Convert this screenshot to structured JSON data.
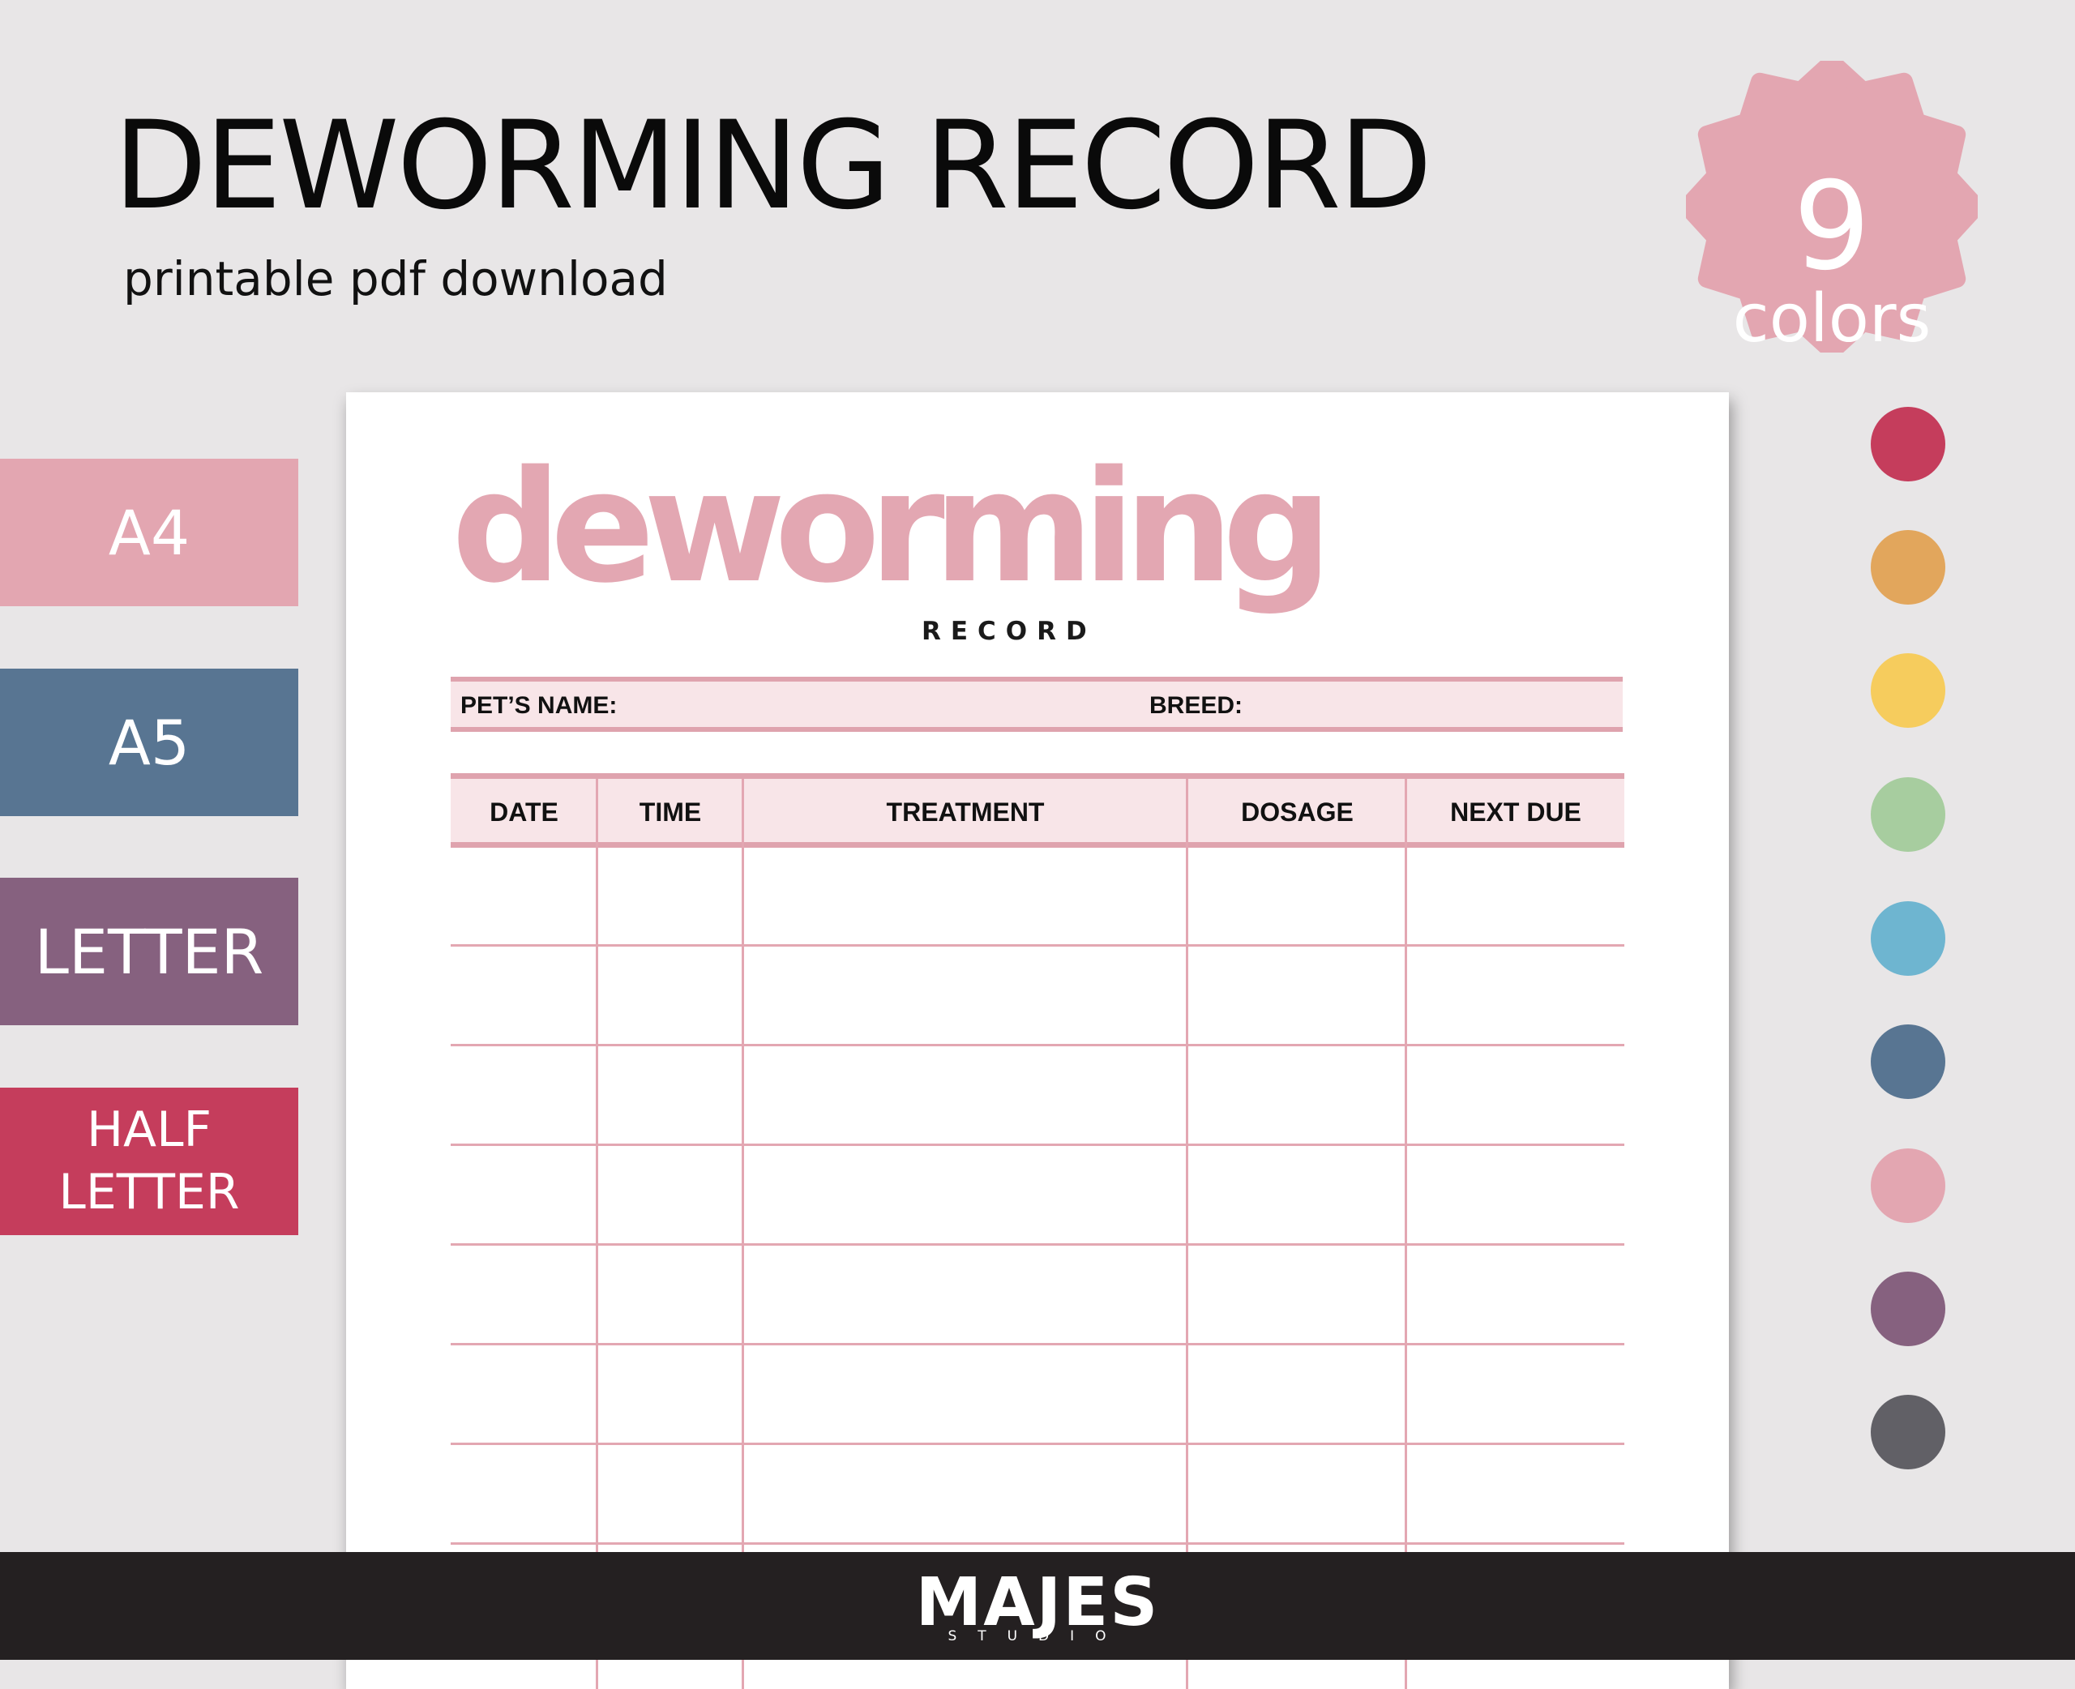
{
  "header": {
    "title": "DEWORMING RECORD",
    "subtitle": "printable pdf download"
  },
  "badge": {
    "number": "9",
    "label": "colors",
    "color": "#e3a6b1"
  },
  "sizes": [
    {
      "label": "A4",
      "color": "#e3a6b1"
    },
    {
      "label": "A5",
      "color": "#587592"
    },
    {
      "label": "LETTER",
      "color": "#86617f"
    },
    {
      "label_line1": "HALF",
      "label_line2": "LETTER",
      "color": "#c53d5c"
    }
  ],
  "sheet": {
    "logo_word": "deworming",
    "logo_sub": "RECORD",
    "pet_name_label": "PET’S NAME:",
    "breed_label": "BREED:",
    "columns": [
      "DATE",
      "TIME",
      "TREATMENT",
      "DOSAGE",
      "NEXT DUE"
    ],
    "accent_color": "#e3a7b2",
    "fill_color": "#f8e5e8"
  },
  "palette": [
    {
      "name": "crimson",
      "color": "#c53d5c"
    },
    {
      "name": "orange",
      "color": "#e2a65c"
    },
    {
      "name": "yellow",
      "color": "#f6cc5d"
    },
    {
      "name": "green",
      "color": "#a7cd9f"
    },
    {
      "name": "sky-blue",
      "color": "#6eb5d0"
    },
    {
      "name": "slate-blue",
      "color": "#587592"
    },
    {
      "name": "pink",
      "color": "#e3a6b1"
    },
    {
      "name": "purple",
      "color": "#86617f"
    },
    {
      "name": "charcoal",
      "color": "#616066"
    }
  ],
  "footer": {
    "brand": "MAJES",
    "brand_sub": "STUDIO"
  }
}
